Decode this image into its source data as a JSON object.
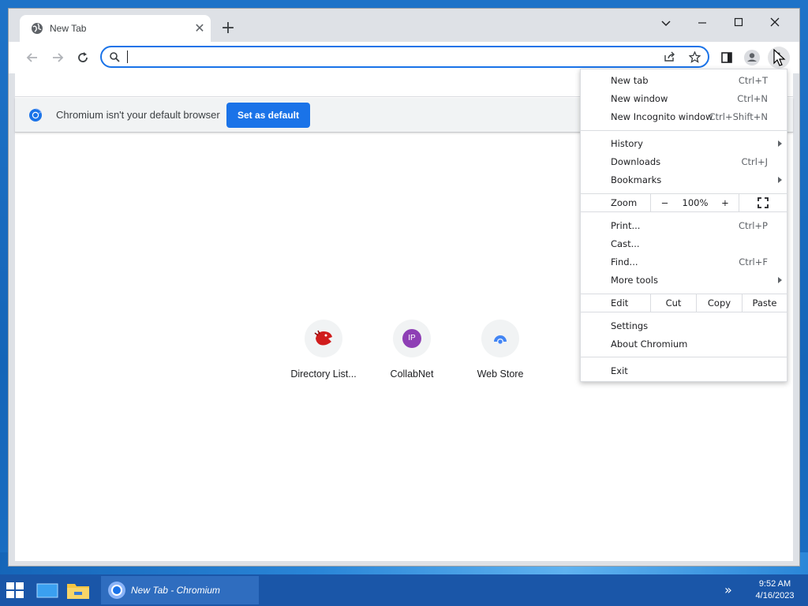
{
  "window": {
    "tab_title": "New Tab",
    "tab_close": "✕",
    "new_tab": "+"
  },
  "omnibox": {
    "value": "",
    "placeholder": ""
  },
  "infobar": {
    "message": "Chromium isn't your default browser",
    "button": "Set as default"
  },
  "shortcuts": [
    {
      "label": "Directory List...",
      "icon": "red-creature-icon"
    },
    {
      "label": "CollabNet",
      "icon_text": "IP",
      "color": "#8e3fb5"
    },
    {
      "label": "Web Store",
      "icon": "web-store-icon"
    }
  ],
  "menu": {
    "new_tab": {
      "label": "New tab",
      "shortcut": "Ctrl+T"
    },
    "new_window": {
      "label": "New window",
      "shortcut": "Ctrl+N"
    },
    "new_incognito": {
      "label": "New Incognito window",
      "shortcut": "Ctrl+Shift+N"
    },
    "history": {
      "label": "History"
    },
    "downloads": {
      "label": "Downloads",
      "shortcut": "Ctrl+J"
    },
    "bookmarks": {
      "label": "Bookmarks"
    },
    "zoom": {
      "label": "Zoom",
      "minus": "−",
      "value": "100%",
      "plus": "+"
    },
    "print": {
      "label": "Print...",
      "shortcut": "Ctrl+P"
    },
    "cast": {
      "label": "Cast..."
    },
    "find": {
      "label": "Find...",
      "shortcut": "Ctrl+F"
    },
    "more_tools": {
      "label": "More tools"
    },
    "edit": {
      "label": "Edit",
      "cut": "Cut",
      "copy": "Copy",
      "paste": "Paste"
    },
    "settings": {
      "label": "Settings"
    },
    "about": {
      "label": "About Chromium"
    },
    "exit": {
      "label": "Exit"
    }
  },
  "taskbar": {
    "active_window": "New Tab - Chromium",
    "time": "9:52 AM",
    "date": "4/16/2023"
  },
  "colors": {
    "accent": "#1a73e8",
    "taskbar": "#1a56a8"
  }
}
